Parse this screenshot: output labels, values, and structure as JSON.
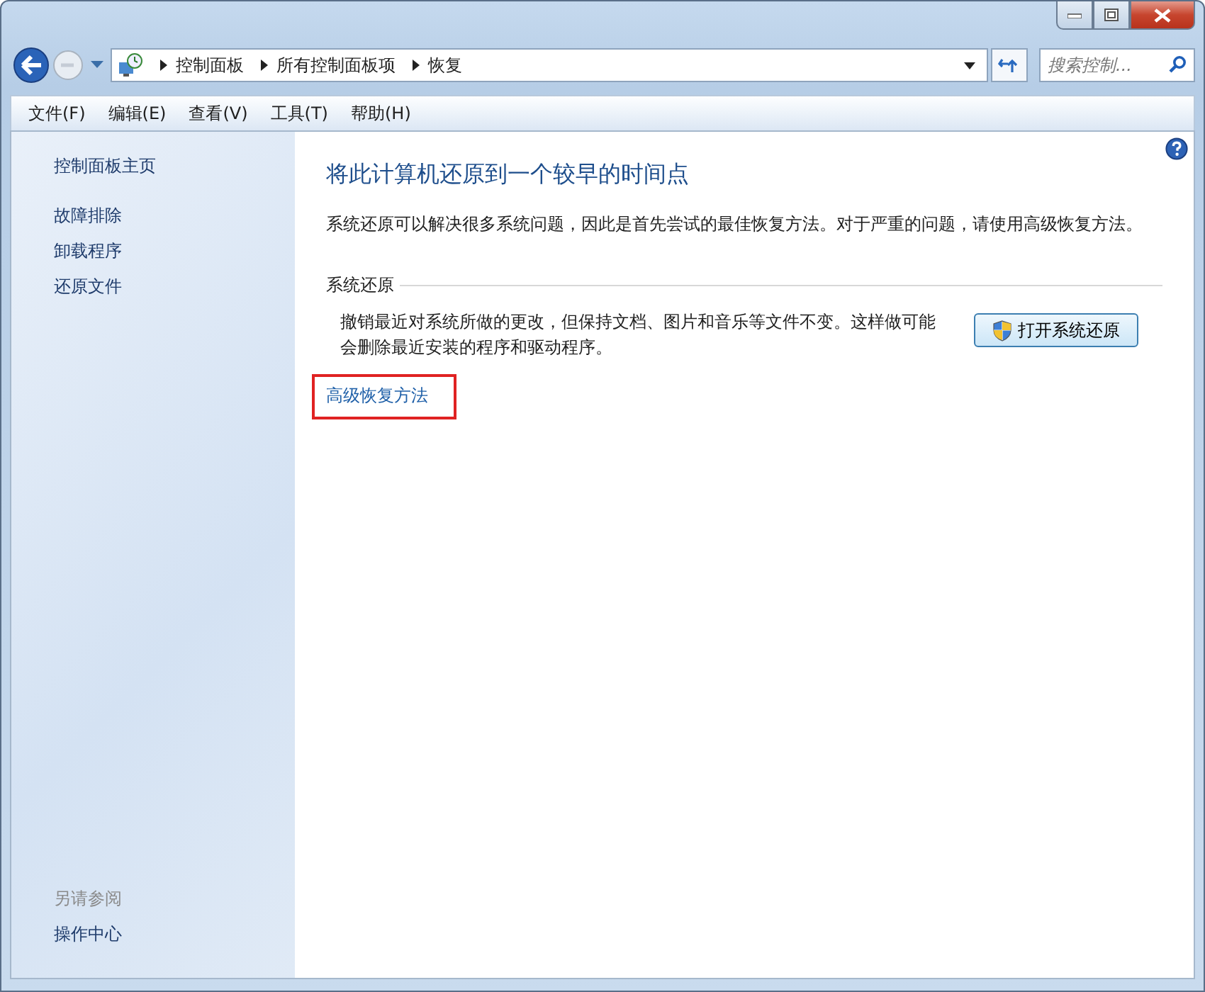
{
  "breadcrumb": [
    "控制面板",
    "所有控制面板项",
    "恢复"
  ],
  "search": {
    "placeholder": "搜索控制..."
  },
  "menu": [
    "文件(F)",
    "编辑(E)",
    "查看(V)",
    "工具(T)",
    "帮助(H)"
  ],
  "sidebar": {
    "home": "控制面板主页",
    "tasks": [
      "故障排除",
      "卸载程序",
      "还原文件"
    ],
    "see_also_heading": "另请参阅",
    "see_also": [
      "操作中心"
    ]
  },
  "main": {
    "title": "将此计算机还原到一个较早的时间点",
    "intro": "系统还原可以解决很多系统问题，因此是首先尝试的最佳恢复方法。对于严重的问题，请使用高级恢复方法。",
    "section": {
      "heading": "系统还原",
      "description": "撤销最近对系统所做的更改，但保持文档、图片和音乐等文件不变。这样做可能会删除最近安装的程序和驱动程序。",
      "button": "打开系统还原"
    },
    "advanced_link": {
      "label": "高级恢复方法",
      "highlighted": true
    }
  }
}
